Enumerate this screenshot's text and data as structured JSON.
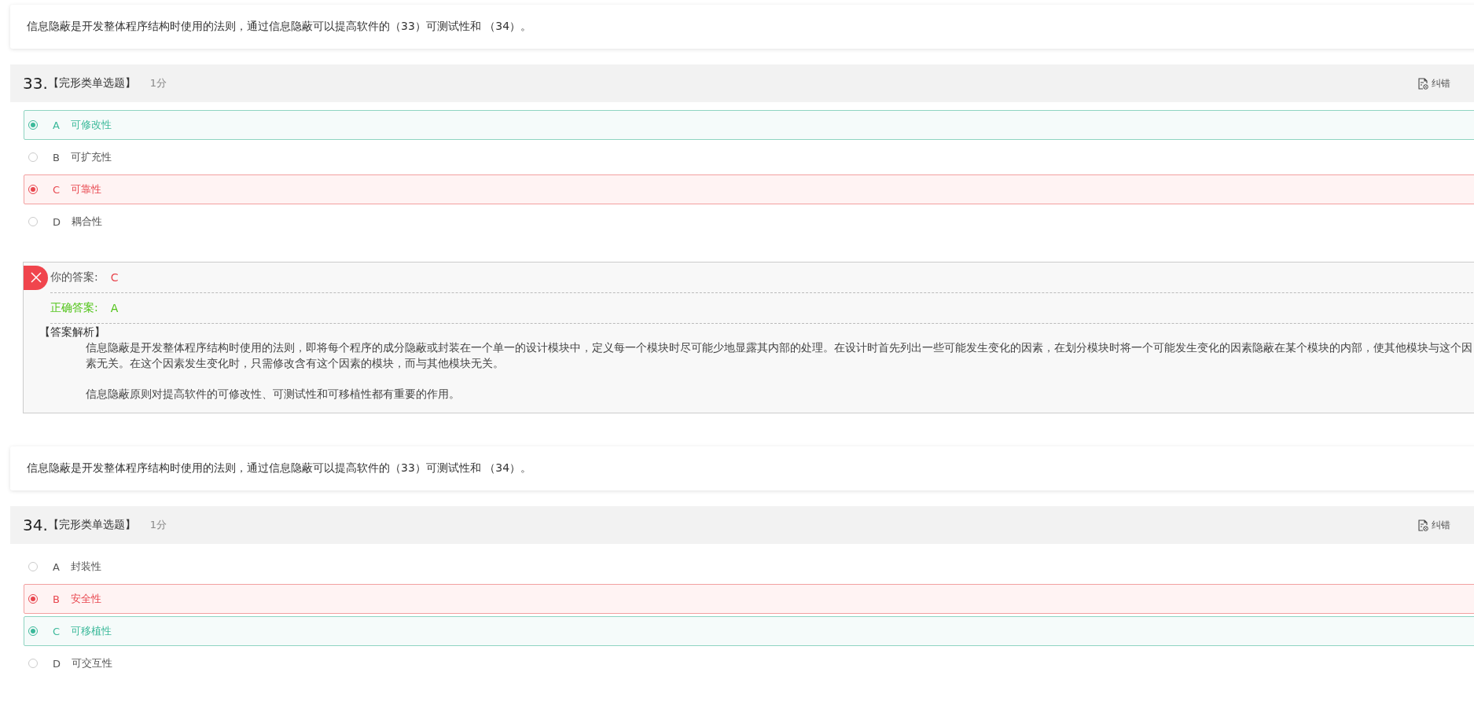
{
  "questions": [
    {
      "stem": "信息隐蔽是开发整体程序结构时使用的法则，通过信息隐蔽可以提高软件的（33）可测试性和 （34）。",
      "number": "33.",
      "type": "【完形类单选题】",
      "score": "1分",
      "report": "纠错",
      "options": [
        {
          "letter": "A",
          "text": "可修改性",
          "selected": true,
          "kind": "correct"
        },
        {
          "letter": "B",
          "text": "可扩充性",
          "selected": false,
          "kind": "plain"
        },
        {
          "letter": "C",
          "text": "可靠性",
          "selected": true,
          "kind": "wrong"
        },
        {
          "letter": "D",
          "text": "耦合性",
          "selected": false,
          "kind": "plain"
        }
      ],
      "review": {
        "is_correct": false,
        "your_label": "你的答案:",
        "your_answer": "C",
        "correct_label": "正确答案:",
        "correct_answer": "A",
        "analysis_title": "【答案解析】",
        "analysis": [
          "信息隐蔽是开发整体程序结构时使用的法则，即将每个程序的成分隐蔽或封装在一个单一的设计模块中，定义每一个模块时尽可能少地显露其内部的处理。在设计时首先列出一些可能发生变化的因素，在划分模块时将一个可能发生变化的因素隐蔽在某个模块的内部，使其他模块与这个因素无关。在这个因素发生变化时，只需修改含有这个因素的模块，而与其他模块无关。",
          "信息隐蔽原则对提高软件的可修改性、可测试性和可移植性都有重要的作用。"
        ]
      }
    },
    {
      "stem": "信息隐蔽是开发整体程序结构时使用的法则，通过信息隐蔽可以提高软件的（33）可测试性和 （34）。",
      "number": "34.",
      "type": "【完形类单选题】",
      "score": "1分",
      "report": "纠错",
      "options": [
        {
          "letter": "A",
          "text": "封装性",
          "selected": false,
          "kind": "plain"
        },
        {
          "letter": "B",
          "text": "安全性",
          "selected": true,
          "kind": "wrong"
        },
        {
          "letter": "C",
          "text": "可移植性",
          "selected": true,
          "kind": "correct"
        },
        {
          "letter": "D",
          "text": "可交互性",
          "selected": false,
          "kind": "plain"
        }
      ]
    }
  ]
}
